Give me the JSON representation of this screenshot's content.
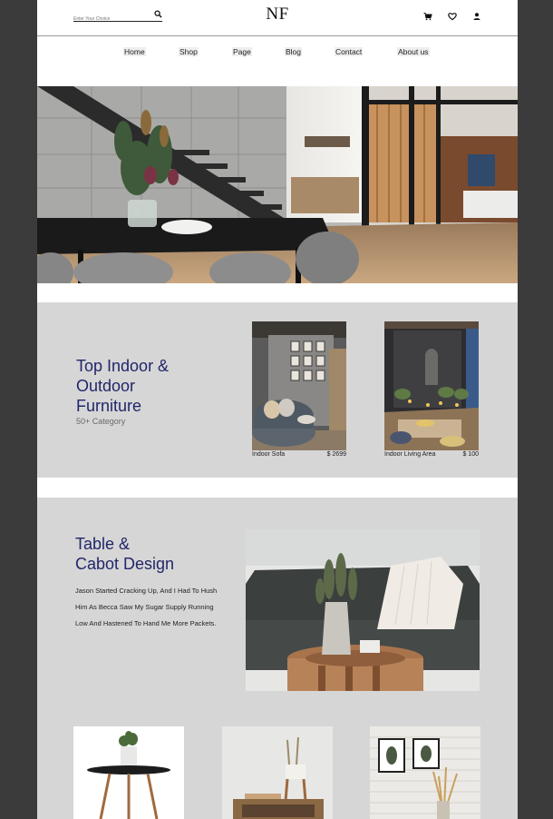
{
  "header": {
    "search_placeholder": "Enter Your Choice",
    "logo": "NF",
    "icons": [
      "search-icon",
      "cart-icon",
      "heart-icon",
      "user-icon"
    ]
  },
  "nav": {
    "items": [
      "Home",
      "Shop",
      "Page",
      "Blog",
      "Contact",
      "About us"
    ]
  },
  "section1": {
    "title": "Top Indoor & Outdoor Furniture",
    "subtitle": "50+ Category",
    "cards": [
      {
        "name": "Indoor Sofa",
        "price": "$ 2699"
      },
      {
        "name": "Indoor Living Area",
        "price": "$ 100"
      }
    ]
  },
  "section2": {
    "title_line1": "Table &",
    "title_line2": "Cabot Design",
    "body": "Jason Started Cracking Up, And I Had To Hush Him As Becca Saw My Sugar Supply Running Low And Hastened To Hand Me More Packets."
  },
  "colors": {
    "page_bg": "#3b3b3b",
    "section_bg": "#d6d6d6",
    "heading": "#22266a"
  }
}
